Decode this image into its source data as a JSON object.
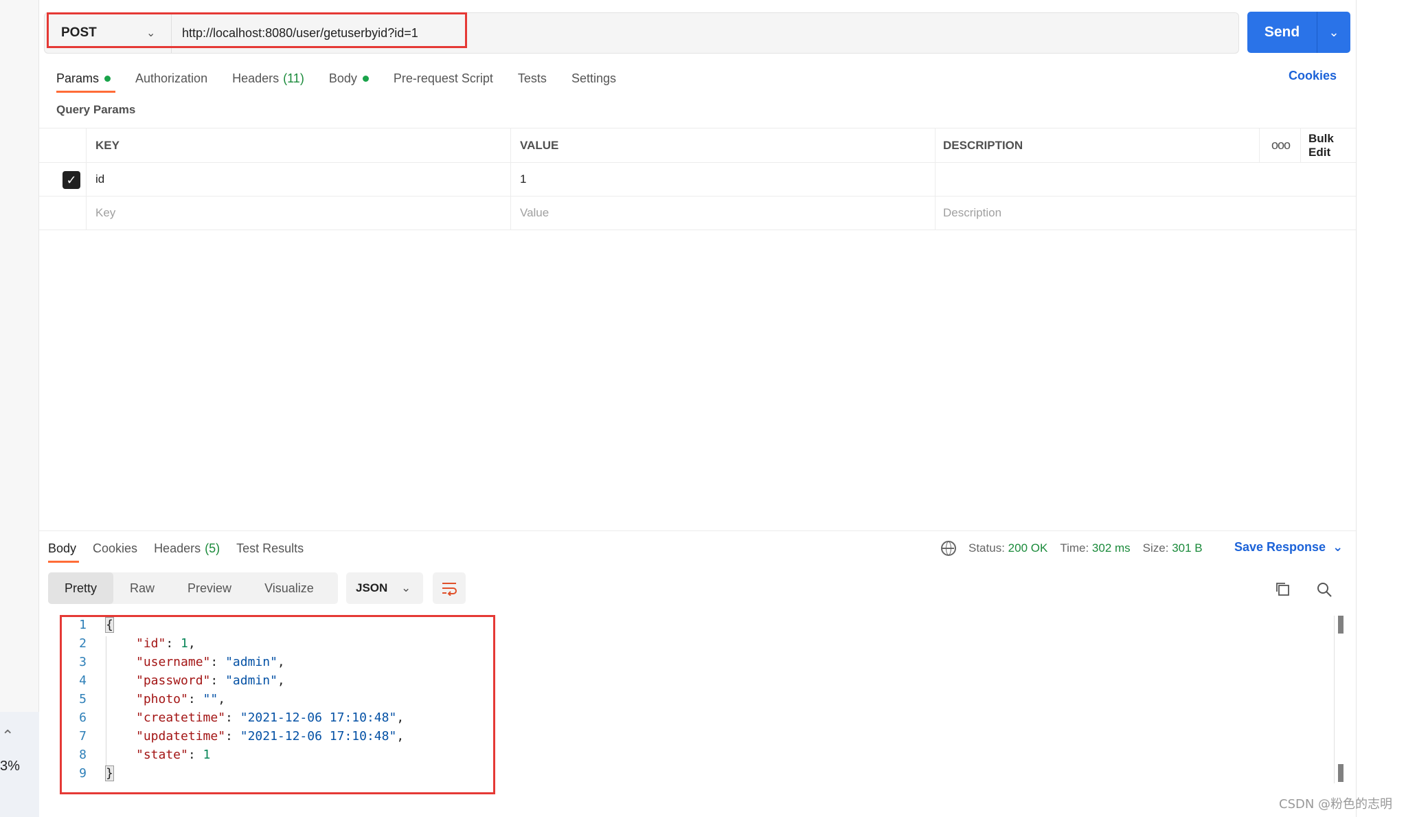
{
  "url_bar": {
    "method": "POST",
    "url": "http://localhost:8080/user/getuserbyid?id=1",
    "send_label": "Send"
  },
  "request_tabs": [
    {
      "label": "Params",
      "active": true,
      "dot": true
    },
    {
      "label": "Authorization"
    },
    {
      "label": "Headers",
      "count": "(11)"
    },
    {
      "label": "Body",
      "dot": true
    },
    {
      "label": "Pre-request Script"
    },
    {
      "label": "Tests"
    },
    {
      "label": "Settings"
    }
  ],
  "cookies_label": "Cookies",
  "query_params": {
    "title": "Query Params",
    "headers": {
      "key": "KEY",
      "value": "VALUE",
      "description": "DESCRIPTION",
      "more": "ooo",
      "bulk_edit": "Bulk Edit"
    },
    "rows": [
      {
        "key": "id",
        "value": "1",
        "description": "",
        "checked": true
      }
    ],
    "placeholders": {
      "key": "Key",
      "value": "Value",
      "description": "Description"
    }
  },
  "response": {
    "tabs": [
      {
        "label": "Body",
        "active": true
      },
      {
        "label": "Cookies"
      },
      {
        "label": "Headers",
        "count": "(5)"
      },
      {
        "label": "Test Results"
      }
    ],
    "status_label": "Status:",
    "status_value": "200 OK",
    "time_label": "Time:",
    "time_value": "302 ms",
    "size_label": "Size:",
    "size_value": "301 B",
    "save_label": "Save Response",
    "view_modes": [
      "Pretty",
      "Raw",
      "Preview",
      "Visualize"
    ],
    "active_view": "Pretty",
    "format": "JSON",
    "lines": [
      {
        "n": "1",
        "text": "{"
      },
      {
        "n": "2",
        "key": "\"id\"",
        "val": "1",
        "type": "num",
        "trail": ","
      },
      {
        "n": "3",
        "key": "\"username\"",
        "val": "\"admin\"",
        "type": "str",
        "trail": ","
      },
      {
        "n": "4",
        "key": "\"password\"",
        "val": "\"admin\"",
        "type": "str",
        "trail": ","
      },
      {
        "n": "5",
        "key": "\"photo\"",
        "val": "\"\"",
        "type": "str",
        "trail": ","
      },
      {
        "n": "6",
        "key": "\"createtime\"",
        "val": "\"2021-12-06 17:10:48\"",
        "type": "str",
        "trail": ","
      },
      {
        "n": "7",
        "key": "\"updatetime\"",
        "val": "\"2021-12-06 17:10:48\"",
        "type": "str",
        "trail": ","
      },
      {
        "n": "8",
        "key": "\"state\"",
        "val": "1",
        "type": "num",
        "trail": ""
      },
      {
        "n": "9",
        "text": "}"
      }
    ]
  },
  "left_panel": {
    "percent": "3%"
  },
  "watermark": "CSDN @粉色的志明",
  "colors": {
    "accent": "#2a73e8",
    "tab_indicator": "#ff6c37",
    "status_ok": "#1a8a3a",
    "highlight_box": "#e53935"
  }
}
